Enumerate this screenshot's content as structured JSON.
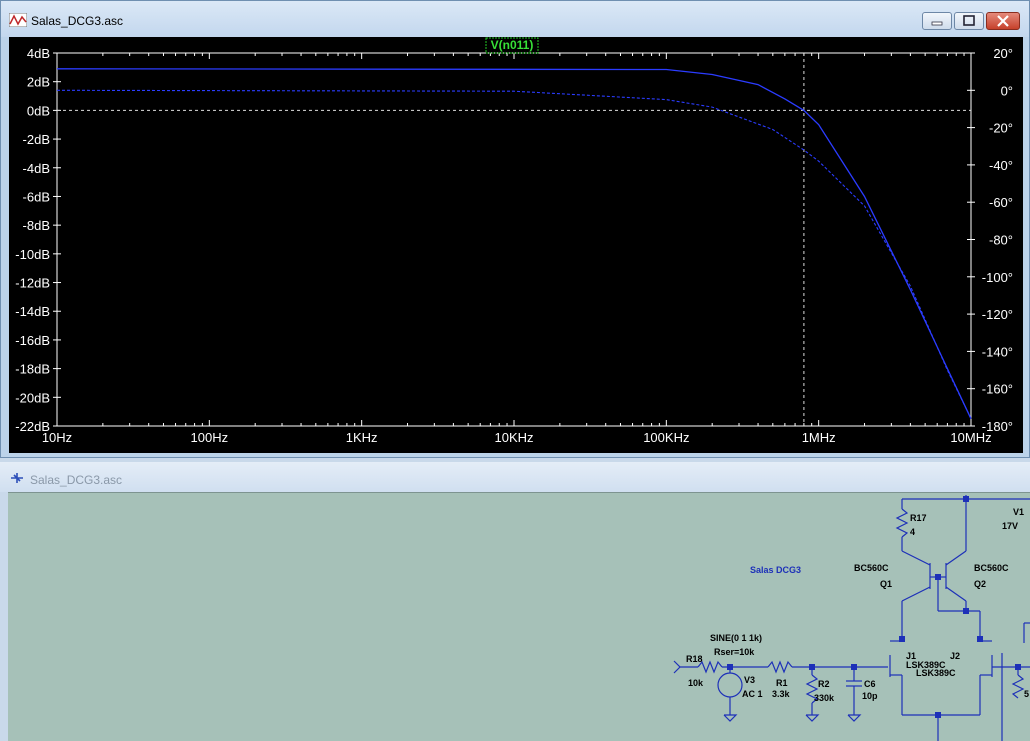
{
  "plot_window": {
    "title": "Salas_DCG3.asc"
  },
  "schematic_window": {
    "title": "Salas_DCG3.asc"
  },
  "chart_data": {
    "type": "line",
    "trace_label": "V(n011)",
    "x_scale": "log",
    "x_ticks": [
      "10Hz",
      "100Hz",
      "1KHz",
      "10KHz",
      "100KHz",
      "1MHz",
      "10MHz"
    ],
    "y_left_ticks": [
      "4dB",
      "2dB",
      "0dB",
      "-2dB",
      "-4dB",
      "-6dB",
      "-8dB",
      "-10dB",
      "-12dB",
      "-14dB",
      "-16dB",
      "-18dB",
      "-20dB",
      "-22dB"
    ],
    "y_right_ticks": [
      "20°",
      "0°",
      "-20°",
      "-40°",
      "-60°",
      "-80°",
      "-100°",
      "-120°",
      "-140°",
      "-160°",
      "-180°"
    ],
    "ylim_db": [
      -22,
      4
    ],
    "ylim_deg": [
      -180,
      20
    ],
    "xlim_hz": [
      10,
      10000000
    ],
    "cursor": {
      "freq_hz": 800000,
      "level_db": 0
    },
    "series": [
      {
        "style": "solid",
        "unit": "dB",
        "x": [
          10,
          100000,
          200000,
          400000,
          600000,
          800000,
          1000000,
          2000000,
          4000000,
          7000000,
          10000000
        ],
        "y": [
          2.9,
          2.85,
          2.5,
          1.8,
          0.8,
          0,
          -1.0,
          -6.0,
          -12.5,
          -18.0,
          -21.5
        ]
      },
      {
        "style": "dashed",
        "unit": "deg",
        "x": [
          10,
          10000,
          100000,
          200000,
          500000,
          800000,
          1000000,
          2000000,
          4000000,
          7000000,
          10000000
        ],
        "y": [
          0,
          -0.5,
          -5,
          -9,
          -21,
          -32,
          -38,
          -62,
          -105,
          -150,
          -176
        ]
      }
    ]
  },
  "schematic": {
    "title_label": "Salas DCG3",
    "components": [
      {
        "ref": "R17",
        "value": "4"
      },
      {
        "ref": "Q1",
        "value": "BC560C"
      },
      {
        "ref": "Q2",
        "value": "BC560C"
      },
      {
        "ref": "V1",
        "value": "17V"
      },
      {
        "ref": "J1",
        "value": "LSK389C"
      },
      {
        "ref": "J2",
        "value": "LSK389C"
      },
      {
        "ref": "R18",
        "value": "10k"
      },
      {
        "ref": "V3",
        "value": "AC 1",
        "spec1": "SINE(0 1 1k)",
        "spec2": "Rser=10k"
      },
      {
        "ref": "R1",
        "value": "3.3k"
      },
      {
        "ref": "R2",
        "value": "330k"
      },
      {
        "ref": "C6",
        "value": "10p"
      }
    ],
    "partial_value": "5"
  }
}
